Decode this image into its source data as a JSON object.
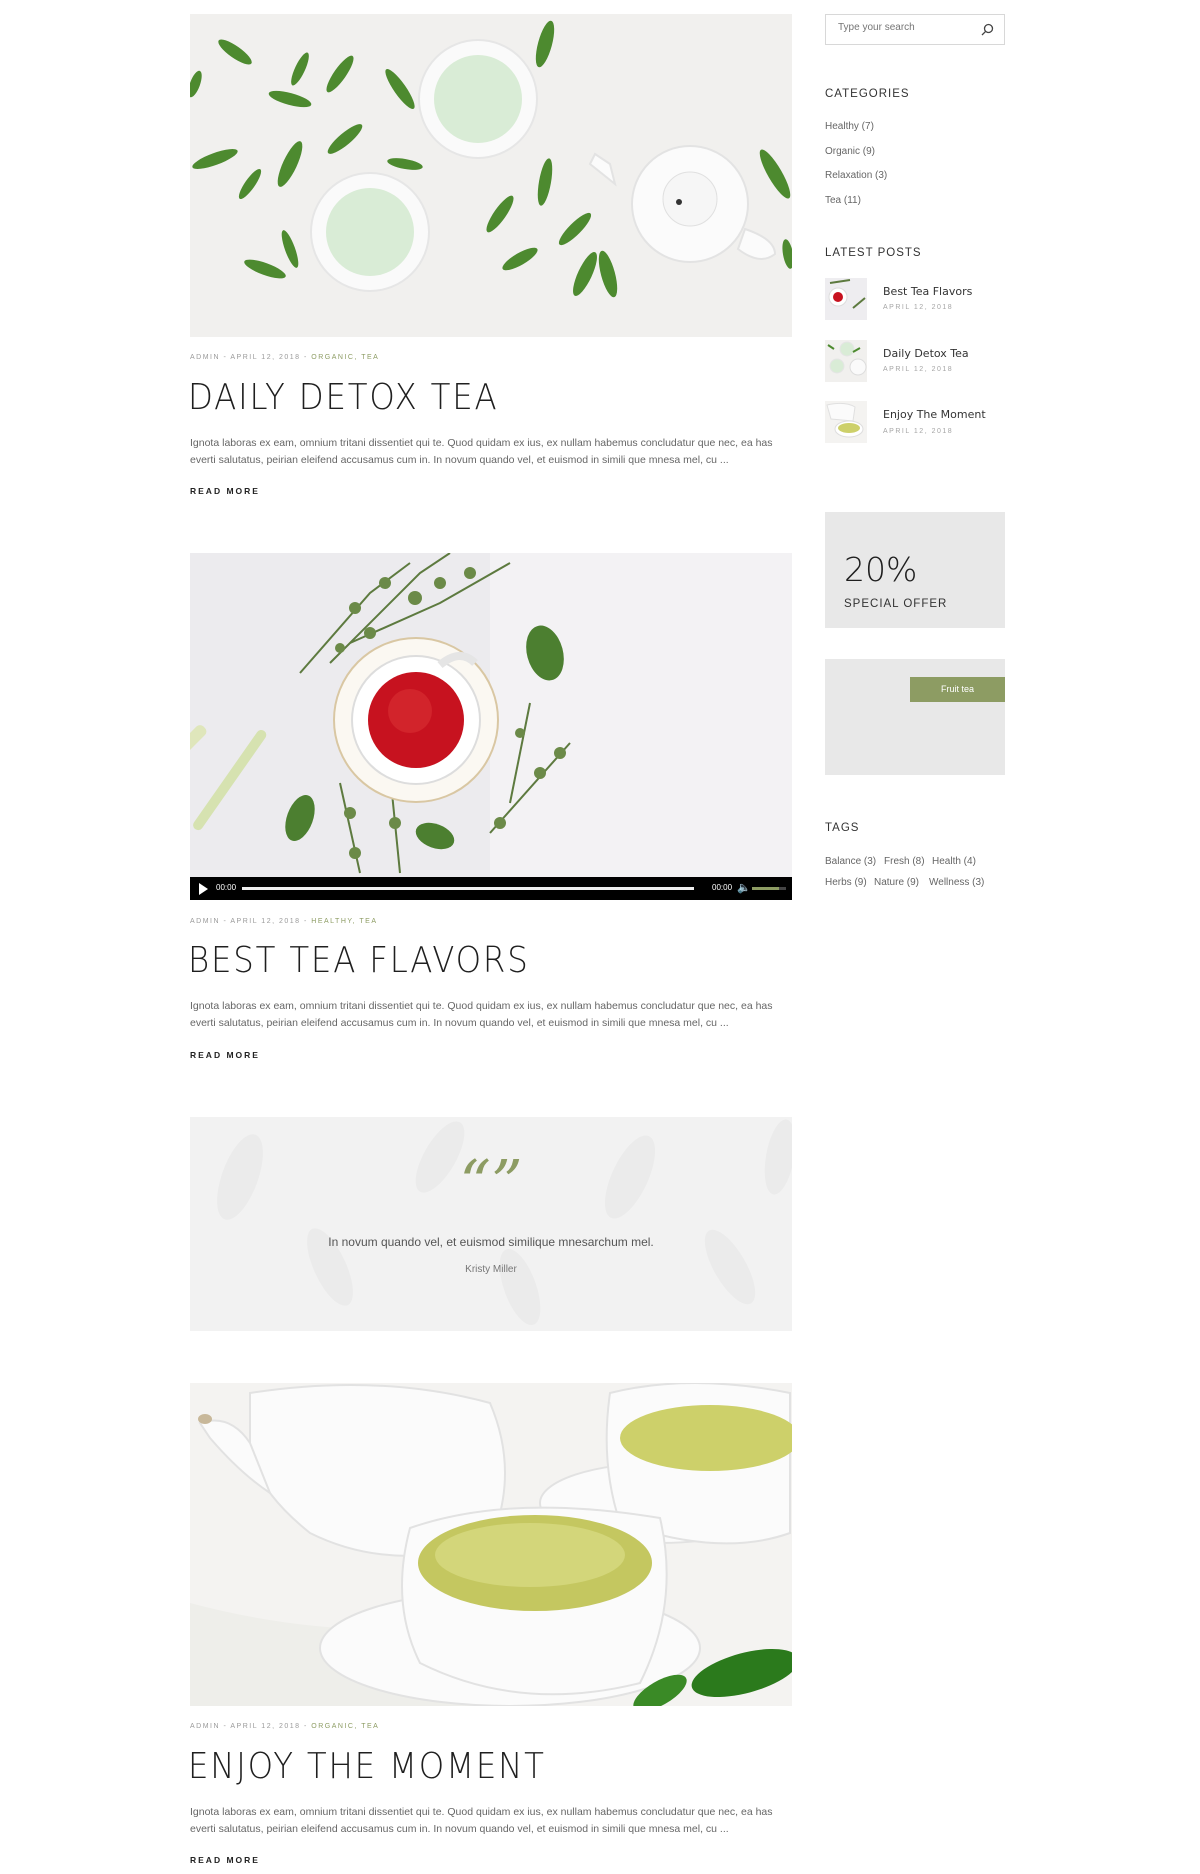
{
  "posts": [
    {
      "meta_prefix": "ADMIN - APRIL 12, 2018 - ",
      "categories": "ORGANIC, TEA",
      "title": "DAILY DETOX TEA",
      "excerpt": "Ignota laboras ex eam, omnium tritani dissentiet qui te. Quod quidam ex ius, ex nullam habemus concludatur que nec, ea has everti salutatus, peirian eleifend accusamus cum in. In novum quando vel, et euismod in simili que mnesa mel, cu ...",
      "read_more": "READ MORE"
    },
    {
      "meta_prefix": "ADMIN - APRIL 12, 2018 - ",
      "categories": "HEALTHY, TEA",
      "title": "BEST TEA FLAVORS",
      "excerpt": "Ignota laboras ex eam, omnium tritani dissentiet qui te. Quod quidam ex ius, ex nullam habemus concludatur que nec, ea has everti salutatus, peirian eleifend accusamus cum in. In novum quando vel, et euismod in simili que mnesa mel, cu ...",
      "read_more": "READ MORE",
      "video": {
        "current_time": "00:00",
        "duration": "00:00",
        "progress": 0,
        "volume": 0.8
      }
    },
    {
      "meta_prefix": "ADMIN - APRIL 12, 2018 - ",
      "categories": "ORGANIC, TEA",
      "title": "ENJOY THE MOMENT",
      "excerpt": "Ignota laboras ex eam, omnium tritani dissentiet qui te. Quod quidam ex ius, ex nullam habemus concludatur que nec, ea has everti salutatus, peirian eleifend accusamus cum in. In novum quando vel, et euismod in simili que mnesa mel, cu ...",
      "read_more": "READ MORE"
    }
  ],
  "quote": {
    "mark": "“”",
    "text": "In novum quando vel, et euismod similique mnesarchum mel.",
    "author": "Kristy Miller"
  },
  "sidebar": {
    "search_placeholder": "Type your search",
    "categories_title": "CATEGORIES",
    "categories": [
      "Healthy (7)",
      "Organic (9)",
      "Relaxation (3)",
      "Tea (11)"
    ],
    "latest_title": "LATEST POSTS",
    "latest_posts": [
      {
        "title": "Best Tea Flavors",
        "date": "APRIL 12, 2018"
      },
      {
        "title": "Daily Detox Tea",
        "date": "APRIL 12, 2018"
      },
      {
        "title": "Enjoy The Moment",
        "date": "APRIL 12, 2018"
      }
    ],
    "offer_percent": "20%",
    "offer_label": "SPECIAL OFFER",
    "fruit_button": "Fruit tea",
    "tags_title": "TAGS",
    "tags": [
      "Balance (3)",
      "Fresh (8)",
      "Health (4)",
      "Herbs (9)",
      "Nature (9)",
      "Wellness (3)"
    ]
  },
  "colors": {
    "accent": "#8d9c63",
    "title": "#1f1f1f",
    "text": "#666666",
    "panel": "#e8e8e8"
  },
  "icons": {
    "search": "search-icon",
    "play": "play-icon",
    "volume": "volume-icon",
    "quote": "quote-mark-icon"
  }
}
